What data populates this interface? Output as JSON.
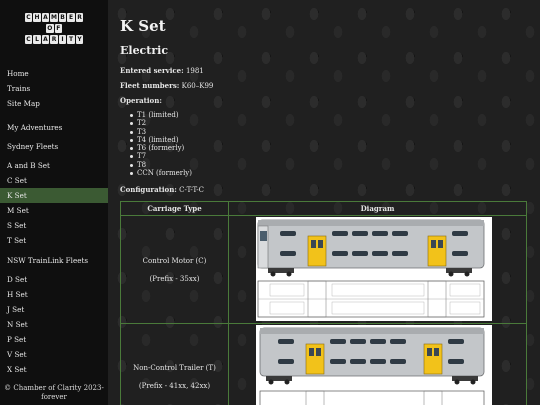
{
  "sidebar": {
    "logo_rows": [
      [
        "C",
        "H",
        "A",
        "M",
        "B",
        "E",
        "R"
      ],
      [
        "O",
        "F"
      ],
      [
        "C",
        "L",
        "A",
        "R",
        "I",
        "T",
        "Y"
      ]
    ],
    "items": [
      {
        "label": "Home",
        "active": false
      },
      {
        "label": "Trains",
        "active": false
      },
      {
        "label": "Site Map",
        "active": false
      },
      {
        "label": "My Adventures",
        "active": false
      },
      {
        "label": "Sydney Fleets",
        "active": false
      },
      {
        "label": "A and B Set",
        "active": false
      },
      {
        "label": "C Set",
        "active": false
      },
      {
        "label": "K Set",
        "active": true
      },
      {
        "label": "M Set",
        "active": false
      },
      {
        "label": "S Set",
        "active": false
      },
      {
        "label": "T Set",
        "active": false
      },
      {
        "label": "NSW TrainLink Fleets",
        "active": false
      },
      {
        "label": "D Set",
        "active": false
      },
      {
        "label": "H Set",
        "active": false
      },
      {
        "label": "J Set",
        "active": false
      },
      {
        "label": "N Set",
        "active": false
      },
      {
        "label": "P Set",
        "active": false
      },
      {
        "label": "V Set",
        "active": false
      },
      {
        "label": "X Set",
        "active": false
      }
    ],
    "footer": "© Chamber of Clarity 2023-forever"
  },
  "page": {
    "title": "K Set",
    "subtitle": "Electric",
    "entered_label": "Entered service:",
    "entered_value": "1981",
    "fleet_label": "Fleet numbers:",
    "fleet_value": "K60–K99",
    "operation_label": "Operation:",
    "operation": [
      "T1 (limited)",
      "T2",
      "T3",
      "T4 (limited)",
      "T6 (formerly)",
      "T7",
      "T8",
      "CCN (formerly)"
    ],
    "config_label": "Configuration:",
    "config_value": "C-T-T-C"
  },
  "table": {
    "headers": [
      "Carriage Type",
      "Diagram"
    ],
    "rows": [
      {
        "type": "Control Motor (C)",
        "prefix": "(Prefix - 35xx)"
      },
      {
        "type": "Non-Control Trailer (T)",
        "prefix": "(Prefix - 41xx, 42xx)"
      }
    ]
  },
  "colors": {
    "active_nav": "#3b5a33",
    "table_border": "#4a7a3a",
    "train_yellow": "#f2c21a",
    "train_silver": "#b9bcbf"
  }
}
